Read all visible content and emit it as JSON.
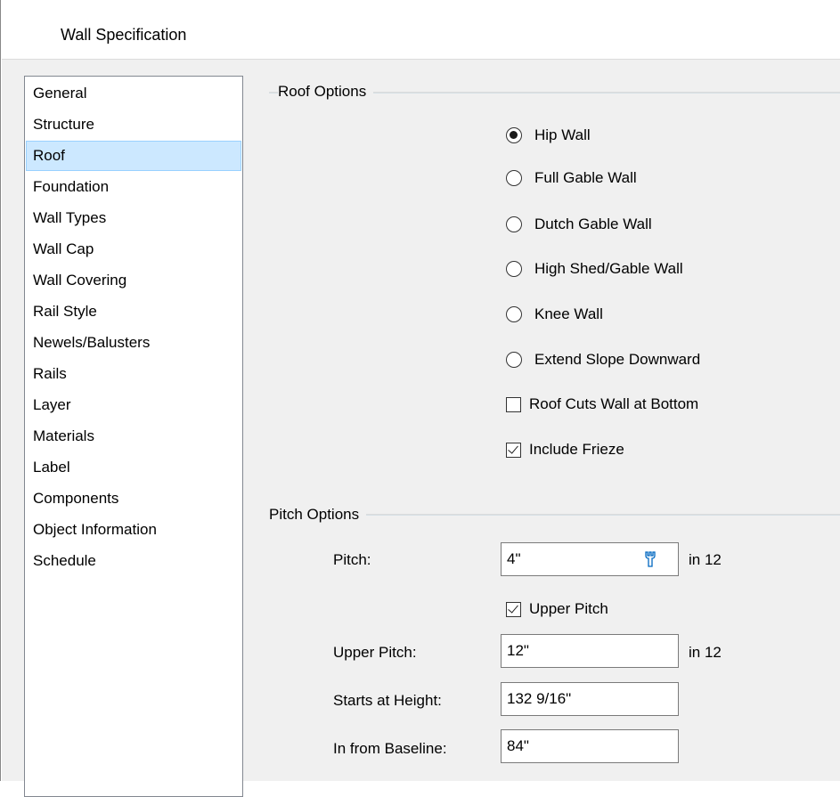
{
  "window": {
    "title": "Wall Specification"
  },
  "nav": {
    "items": [
      {
        "label": "General"
      },
      {
        "label": "Structure"
      },
      {
        "label": "Roof",
        "selected": true
      },
      {
        "label": "Foundation"
      },
      {
        "label": "Wall Types"
      },
      {
        "label": "Wall Cap"
      },
      {
        "label": "Wall Covering"
      },
      {
        "label": "Rail Style"
      },
      {
        "label": "Newels/Balusters"
      },
      {
        "label": "Rails"
      },
      {
        "label": "Layer"
      },
      {
        "label": "Materials"
      },
      {
        "label": "Label"
      },
      {
        "label": "Components"
      },
      {
        "label": "Object Information"
      },
      {
        "label": "Schedule"
      }
    ]
  },
  "roof_options": {
    "group_label": "Roof Options",
    "radios": [
      {
        "label": "Hip Wall",
        "checked": true
      },
      {
        "label": "Full Gable Wall",
        "checked": false
      },
      {
        "label": "Dutch Gable Wall",
        "checked": false
      },
      {
        "label": "High Shed/Gable Wall",
        "checked": false
      },
      {
        "label": "Knee Wall",
        "checked": false
      },
      {
        "label": "Extend Slope Downward",
        "checked": false
      }
    ],
    "roof_cuts_wall": {
      "label": "Roof Cuts Wall at Bottom",
      "checked": false
    },
    "include_frieze": {
      "label": "Include Frieze",
      "checked": true
    }
  },
  "pitch_options": {
    "group_label": "Pitch Options",
    "pitch": {
      "label": "Pitch:",
      "value": "4\"",
      "unit": "in 12",
      "icon": "wrench-icon"
    },
    "upper_pitch_check": {
      "label": "Upper Pitch",
      "checked": true
    },
    "upper_pitch": {
      "label": "Upper Pitch:",
      "value": "12\"",
      "unit": "in 12"
    },
    "starts_at_height": {
      "label": "Starts at Height:",
      "value": "132 9/16\""
    },
    "in_from_baseline": {
      "label": "In from Baseline:",
      "value": "84\""
    }
  }
}
